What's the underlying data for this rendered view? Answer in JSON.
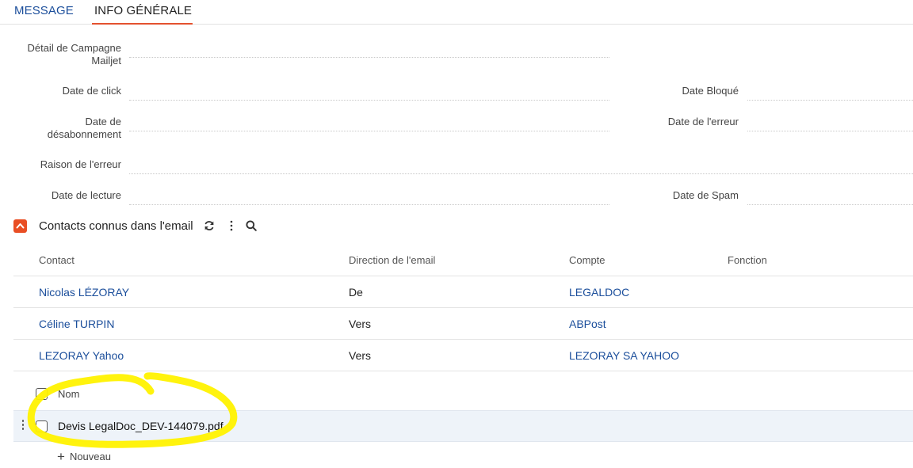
{
  "tabs": [
    {
      "label": "MESSAGE",
      "active": false
    },
    {
      "label": "INFO GÉNÉRALE",
      "active": true
    }
  ],
  "fields": {
    "detail_campagne_line1": "Détail de Campagne",
    "detail_campagne_line2": "Mailjet",
    "date_click": "Date de click",
    "date_bloque": "Date Bloqué",
    "date_desabo_line1": "Date de",
    "date_desabo_line2": "désabonnement",
    "date_erreur": "Date de l'erreur",
    "raison_erreur": "Raison de l'erreur",
    "date_lecture": "Date de lecture",
    "date_spam": "Date de Spam"
  },
  "contacts_section": {
    "title": "Contacts connus dans l'email",
    "icons": [
      "chevron-up-icon",
      "refresh-icon",
      "kebab-menu-icon",
      "search-icon"
    ],
    "columns": [
      "Contact",
      "Direction de l'email",
      "Compte",
      "Fonction"
    ],
    "rows": [
      {
        "contact": "Nicolas LÉZORAY",
        "direction": "De",
        "compte": "LEGALDOC",
        "fonction": ""
      },
      {
        "contact": "Céline TURPIN",
        "direction": "Vers",
        "compte": "ABPost",
        "fonction": ""
      },
      {
        "contact": "LEZORAY Yahoo",
        "direction": "Vers",
        "compte": "LEZORAY SA YAHOO",
        "fonction": ""
      }
    ]
  },
  "attachments": {
    "header": "Nom",
    "items": [
      {
        "name": "Devis LegalDoc_DEV-144079.pdf"
      }
    ],
    "new_label": "Nouveau"
  },
  "colors": {
    "link": "#1b4e9b",
    "accent": "#e94e24",
    "highlight": "#fff200",
    "selected_row": "#eef3f9"
  }
}
